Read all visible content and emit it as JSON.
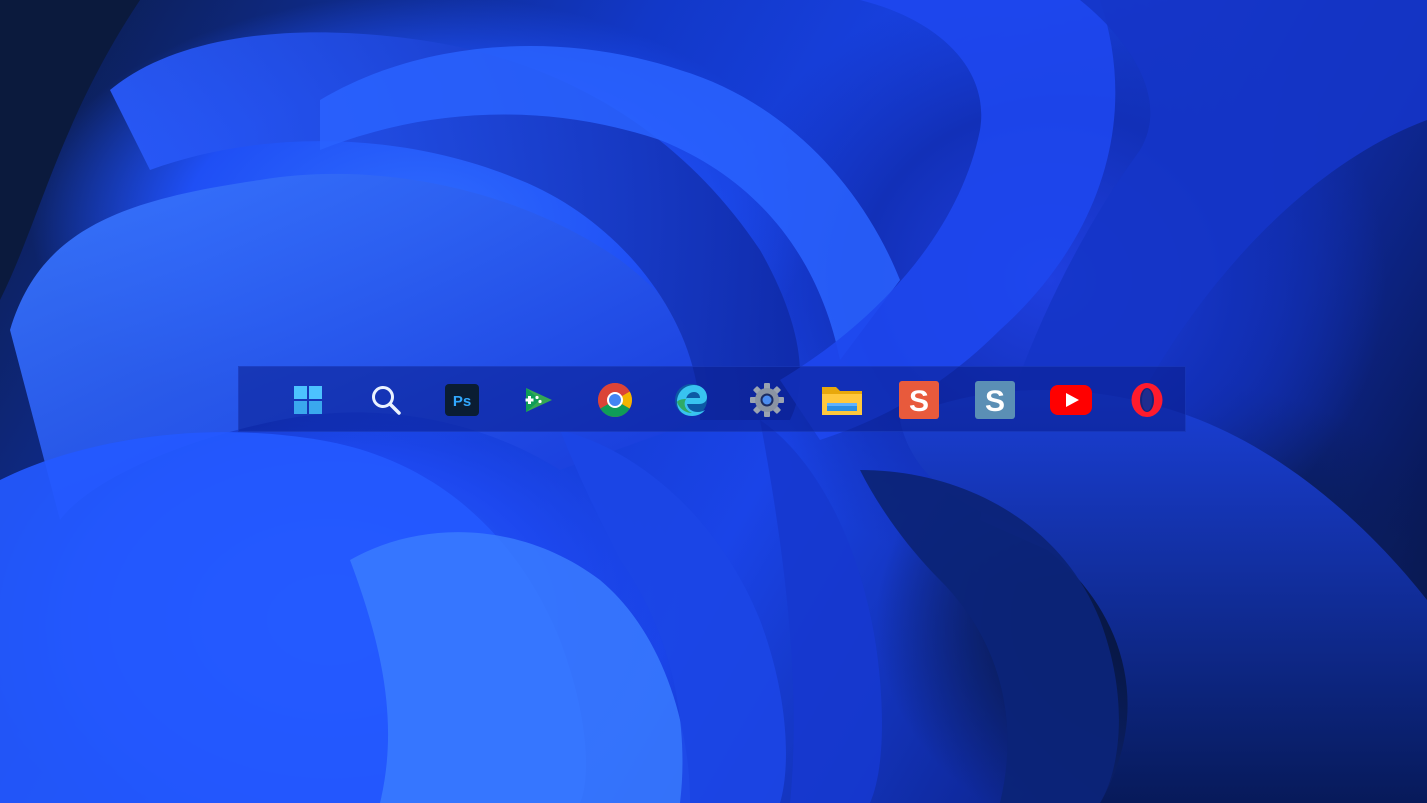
{
  "desktop": {
    "wallpaper": "blue-bloom-wallpaper"
  },
  "taskbar": {
    "items": [
      {
        "id": "start",
        "icon": "windows-start-icon"
      },
      {
        "id": "search",
        "icon": "search-icon"
      },
      {
        "id": "photoshop",
        "icon": "photoshop-icon",
        "label": "Ps"
      },
      {
        "id": "google-play-games",
        "icon": "google-play-games-icon"
      },
      {
        "id": "chrome",
        "icon": "chrome-icon"
      },
      {
        "id": "edge",
        "icon": "edge-icon"
      },
      {
        "id": "settings",
        "icon": "gear-icon"
      },
      {
        "id": "file-explorer",
        "icon": "folder-icon"
      },
      {
        "id": "app-s-orange",
        "icon": "s-app-orange-icon",
        "label": "S"
      },
      {
        "id": "app-s-blue",
        "icon": "s-app-blue-icon",
        "label": "S"
      },
      {
        "id": "youtube",
        "icon": "youtube-icon"
      },
      {
        "id": "opera",
        "icon": "opera-icon"
      }
    ]
  },
  "colors": {
    "windows_blue": "#4cc2ff",
    "photoshop_bg": "#0a1d33",
    "photoshop_text": "#31a8ff",
    "s_orange": "#e85a3c",
    "s_blue": "#5b8fb5",
    "youtube_red": "#ff0000",
    "opera_red": "#ff1b2d"
  }
}
